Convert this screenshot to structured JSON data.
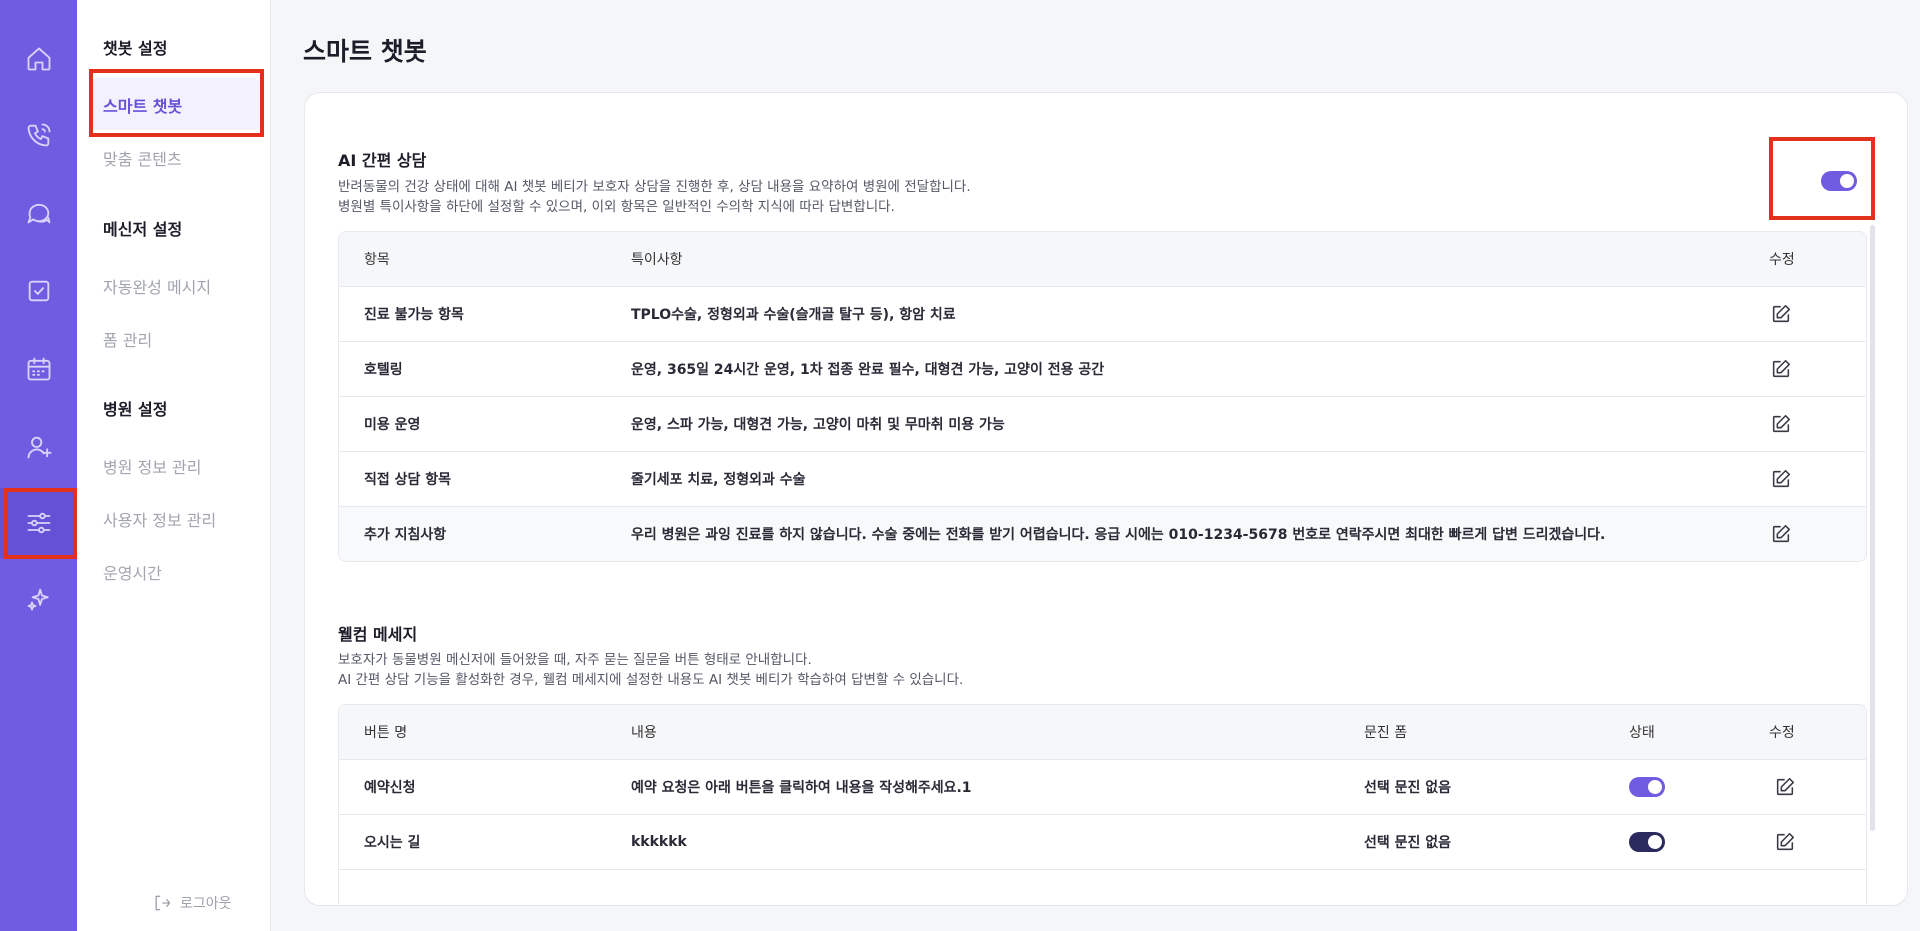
{
  "rail": {
    "items": [
      {
        "name": "home-icon"
      },
      {
        "name": "phone-icon"
      },
      {
        "name": "chat-icon"
      },
      {
        "name": "checkbox-icon"
      },
      {
        "name": "calendar-icon"
      },
      {
        "name": "user-add-icon"
      },
      {
        "name": "settings-sliders-icon",
        "active": true
      },
      {
        "name": "sparkle-icon"
      }
    ]
  },
  "menu": {
    "chatbot_section": "챗봇 설정",
    "smart_chatbot": "스마트 챗봇",
    "custom_content": "맞춤 콘텐츠",
    "messenger_section": "메신저 설정",
    "autocomplete_message": "자동완성 메시지",
    "form_management": "폼 관리",
    "hospital_section": "병원 설정",
    "hospital_info": "병원 정보 관리",
    "user_info": "사용자 정보 관리",
    "operating_hours": "운영시간",
    "logout": "로그아웃"
  },
  "page": {
    "title": "스마트 챗봇"
  },
  "ai_consult": {
    "title": "AI 간편 상담",
    "desc_line1": "반려동물의 건강 상태에 대해 AI 챗봇 베티가 보호자 상담을 진행한 후, 상담 내용을 요약하여 병원에 전달합니다.",
    "desc_line2": "병원별 특이사항을 하단에 설정할 수 있으며, 이외 항목은 일반적인 수의학 지식에 따라 답변합니다.",
    "enabled": true,
    "columns": {
      "item": "항목",
      "note": "특이사항",
      "edit": "수정"
    },
    "rows": [
      {
        "item": "진료 불가능 항목",
        "note": "TPLO수술, 정형외과 수술(슬개골 탈구 등), 항암 치료"
      },
      {
        "item": "호텔링",
        "note": "운영, 365일 24시간 운영, 1차 접종 완료 필수, 대형견 가능, 고양이 전용 공간"
      },
      {
        "item": "미용 운영",
        "note": "운영, 스파 가능, 대형견 가능, 고양이 마취 및 무마취 미용 가능"
      },
      {
        "item": "직접 상담 항목",
        "note": "줄기세포 치료, 정형외과 수술"
      },
      {
        "item": "추가 지침사항",
        "note": "우리 병원은 과잉 진료를 하지 않습니다. 수술 중에는 전화를 받기 어렵습니다. 응급 시에는 010-1234-5678 번호로 연락주시면 최대한 빠르게 답변 드리겠습니다."
      }
    ]
  },
  "welcome": {
    "title": "웰컴 메세지",
    "desc_line1": "보호자가 동물병원 메신저에 들어왔을 때, 자주 묻는 질문을 버튼 형태로 안내합니다.",
    "desc_line2": "AI 간편 상담 기능을 활성화한 경우, 웰컴 메세지에 설정한 내용도 AI 챗봇 베티가 학습하여 답변할 수 있습니다.",
    "columns": {
      "button_name": "버튼 명",
      "content": "내용",
      "form": "문진 폼",
      "status": "상태",
      "edit": "수정"
    },
    "rows": [
      {
        "button_name": "예약신청",
        "content": "예약 요청은 아래 버튼을 클릭하여 내용을 작성해주세요.1",
        "form": "선택 문진 없음",
        "status_on": true,
        "toggle_color": "#6f5ce0"
      },
      {
        "button_name": "오시는 길",
        "content": "kkkkkk",
        "form": "선택 문진 없음",
        "status_on": true,
        "toggle_color": "#2b2a5e"
      }
    ]
  },
  "colors": {
    "accent": "#6f5ce0",
    "highlight": "#e3301b"
  }
}
